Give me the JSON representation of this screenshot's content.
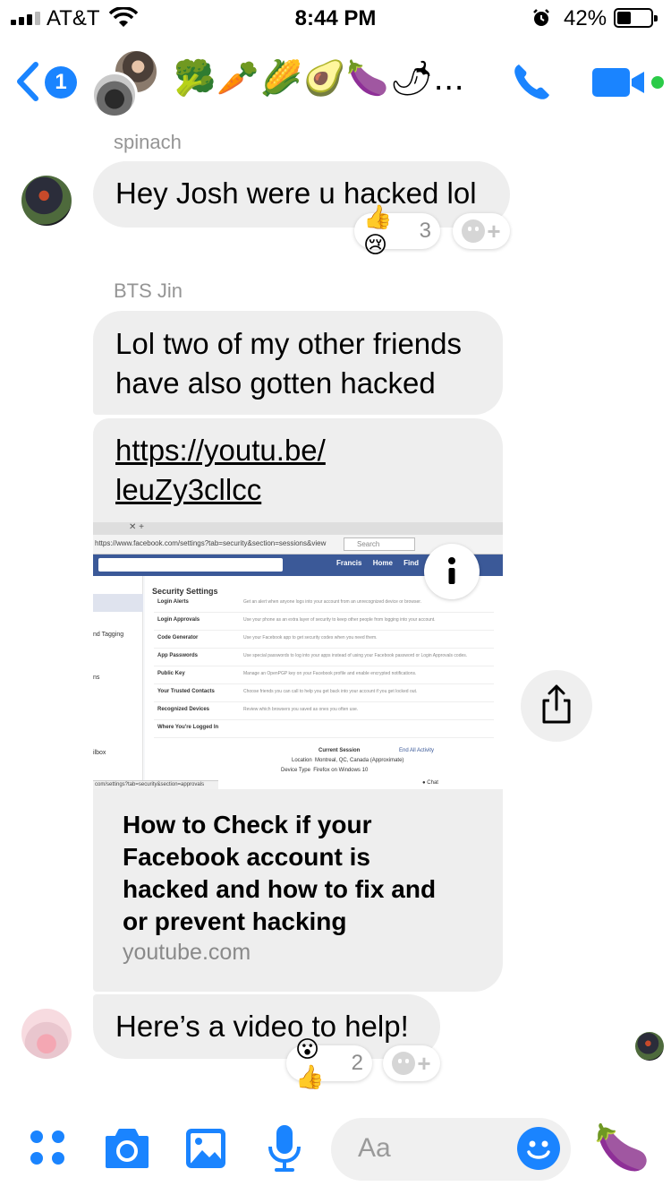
{
  "status_bar": {
    "carrier": "AT&T",
    "time": "8:44 PM",
    "battery_percent": "42%",
    "battery_level": 0.42,
    "signal_bars": 3
  },
  "header": {
    "back_count": "1",
    "thread_title": "🥦🥕🌽🥑🍆🌶...",
    "icons": [
      "back-chevron-icon",
      "phone-icon",
      "video-camera-icon"
    ],
    "accent_color": "#1a84ff",
    "online_color": "#2bcb48"
  },
  "messages": [
    {
      "sender": "spinach",
      "text": "Hey Josh were u hacked lol",
      "reactions": {
        "emojis": "👍😢",
        "count": "3"
      }
    },
    {
      "sender": "BTS Jin",
      "text_lines": [
        "Lol two of my other friends",
        "have also gotten hacked"
      ]
    },
    {
      "link": {
        "url_lines": [
          "https://youtu.be/",
          "leuZy3cllcc"
        ],
        "title_lines": [
          "How to Check if your",
          "Facebook account is",
          "hacked and how to fix and",
          "or prevent hacking"
        ],
        "domain": "youtube.com",
        "preview": {
          "address": "https://www.facebook.com/settings?tab=security&section=sessions&view",
          "search": "Search",
          "page_title": "Security Settings",
          "nav": [
            "Francis",
            "Home",
            "Find Frie"
          ],
          "rows": [
            "Login Alerts",
            "Login Approvals",
            "Code Generator",
            "App Passwords",
            "Public Key",
            "Your Trusted Contacts",
            "Recognized Devices",
            "Where You're Logged In"
          ],
          "row_descriptions": [
            "Get an alert when anyone logs into your account from an unrecognized device or browser.",
            "Use your phone as an extra layer of security to keep other people from logging into your account.",
            "Use your Facebook app to get security codes when you need them.",
            "Use special passwords to log into your apps instead of using your Facebook password or Login Approvals codes.",
            "Manage an OpenPGP key on your Facebook profile and enable encrypted notifications.",
            "Choose friends you can call to help you get back into your account if you get locked out.",
            "Review which browsers you saved as ones you often use.",
            ""
          ],
          "session_label": "Current Session",
          "end_all": "End All Activity",
          "location_label": "Location",
          "location_value": "Montreal, QC, Canada (Approximate)",
          "device_label": "Device Type",
          "device_value": "Firefox on Windows 10",
          "left_items": [
            "nd Tagging",
            "ns",
            "ilbox"
          ],
          "status_url": "com/settings?tab=security&section=approvals",
          "chat": "Chat"
        }
      }
    },
    {
      "text": "Here’s a video to help!",
      "reactions": {
        "emojis": "😮👍",
        "count": "2"
      }
    }
  ],
  "composer": {
    "placeholder": "Aa",
    "like_emoji": "🍆",
    "icons": [
      "apps-grid-icon",
      "camera-icon",
      "photo-icon",
      "microphone-icon",
      "emoji-icon"
    ]
  }
}
